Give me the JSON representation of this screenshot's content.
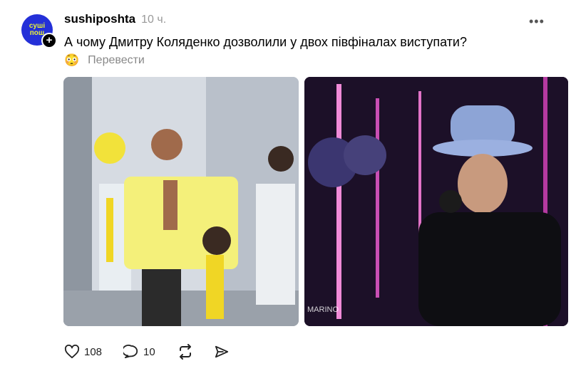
{
  "post": {
    "username": "sushiposhta",
    "time": "10 ч.",
    "text": "А чому Дмитру Коляденко дозволили у двох півфіналах виступати?",
    "translate_label": "Перевести",
    "avatar_text": "суші пош",
    "more_label": "•••"
  },
  "actions": {
    "likes": "108",
    "comments": "10"
  },
  "colors": {
    "avatar_bg": "#2430d8",
    "avatar_text": "#e8f23a"
  }
}
